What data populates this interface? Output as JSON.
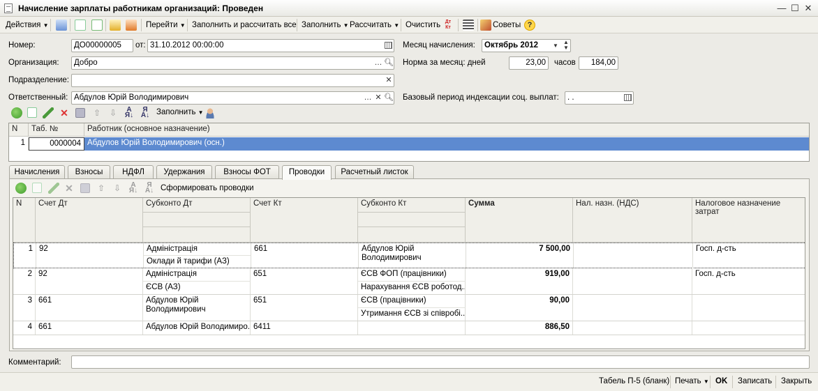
{
  "window": {
    "title": "Начисление зарплаты работникам организаций: Проведен"
  },
  "toolbar": {
    "actions": "Действия",
    "goto": "Перейти",
    "fill_calc_all": "Заполнить и рассчитать все",
    "fill": "Заполнить",
    "calc": "Рассчитать",
    "clear": "Очистить",
    "dtkt": "Дт Кт",
    "tips": "Советы"
  },
  "form": {
    "number_label": "Номер:",
    "number": "ДО00000005",
    "from_label": "от:",
    "date": "31.10.2012 00:00:00",
    "month_label": "Месяц начисления:",
    "month": "Октябрь 2012",
    "org_label": "Организация:",
    "org": "Добро",
    "norm_label": "Норма за месяц: дней",
    "norm_days": "23,00",
    "hours_label": "часов",
    "norm_hours": "184,00",
    "dept_label": "Подразделение:",
    "dept": "",
    "resp_label": "Ответственный:",
    "resp": "Абдулов Юрій Володимирович",
    "base_period_label": "Базовый период индексации соц. выплат:",
    "base_period": " .  ."
  },
  "workers_toolbar": {
    "fill": "Заполнить"
  },
  "workers_grid": {
    "headers": [
      "N",
      "Таб. №",
      "Работник (основное назначение)"
    ],
    "rows": [
      {
        "n": "1",
        "tab": "0000004",
        "worker": "Абдулов Юрій Володимирович (осн.)"
      }
    ]
  },
  "tabs": [
    "Начисления",
    "Взносы",
    "НДФЛ",
    "Удержания",
    "Взносы ФОТ",
    "Проводки",
    "Расчетный листок"
  ],
  "active_tab": "Проводки",
  "entries_toolbar": {
    "form_entries": "Сформировать проводки"
  },
  "entries_grid": {
    "headers": {
      "n": "N",
      "dt": "Счет Дт",
      "sub_dt": "Субконто Дт",
      "kt": "Счет Кт",
      "sub_kt": "Субконто Кт",
      "sum": "Сумма",
      "vat": "Нал. назн. (НДС)",
      "tax": "Налоговое назначение затрат"
    },
    "rows": [
      {
        "n": "1",
        "dt": "92",
        "sub_dt1": "Адміністрація",
        "sub_dt2": "Оклади й тарифи (АЗ)",
        "kt": "661",
        "sub_kt1": "Абдулов Юрій Володимирович",
        "sub_kt2": "",
        "sum": "7 500,00",
        "vat": "",
        "tax": "Госп. д-сть"
      },
      {
        "n": "2",
        "dt": "92",
        "sub_dt1": "Адміністрація",
        "sub_dt2": "ЄСВ (АЗ)",
        "kt": "651",
        "sub_kt1": "ЄСВ ФОП (працівники)",
        "sub_kt2": "Нарахування ЄСВ роботод...",
        "sum": "919,00",
        "vat": "",
        "tax": "Госп. д-сть"
      },
      {
        "n": "3",
        "dt": "661",
        "sub_dt1": "Абдулов Юрій Володимирович",
        "sub_dt2": "",
        "kt": "651",
        "sub_kt1": "ЄСВ (працівники)",
        "sub_kt2": "Утримання ЄСВ зі співробі...",
        "sum": "90,00",
        "vat": "",
        "tax": ""
      },
      {
        "n": "4",
        "dt": "661",
        "sub_dt1": "Абдулов Юрій Володимиро...",
        "sub_dt2": "",
        "kt": "6411",
        "sub_kt1": "",
        "sub_kt2": "",
        "sum": "886,50",
        "vat": "",
        "tax": ""
      }
    ]
  },
  "comment": {
    "label": "Комментарий:",
    "value": ""
  },
  "statusbar": {
    "tabel": "Табель П-5 (бланк)",
    "print": "Печать",
    "ok": "OK",
    "save": "Записать",
    "close": "Закрыть"
  },
  "colors": {
    "selection": "#5d8ad0",
    "background": "#ecebe6"
  }
}
